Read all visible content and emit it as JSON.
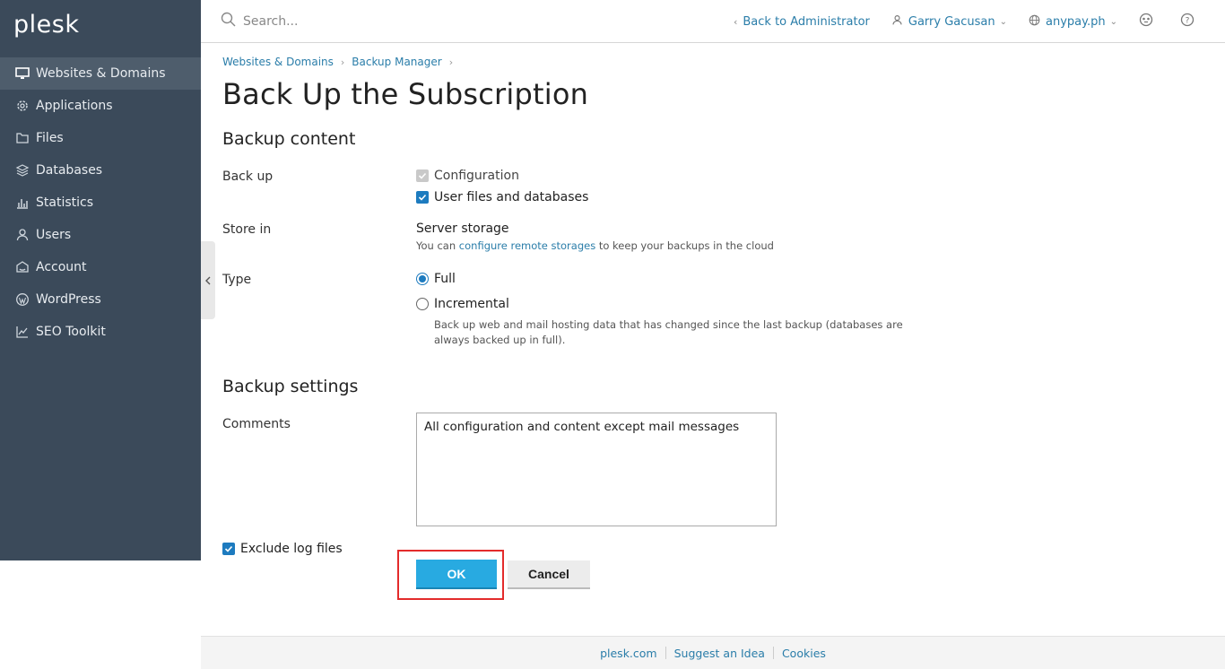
{
  "app": {
    "logo": "plesk"
  },
  "sidebar": {
    "items": [
      {
        "label": "Websites & Domains",
        "icon": "monitor-icon",
        "active": true
      },
      {
        "label": "Applications",
        "icon": "gear-icon"
      },
      {
        "label": "Files",
        "icon": "folder-icon"
      },
      {
        "label": "Databases",
        "icon": "database-layers-icon"
      },
      {
        "label": "Statistics",
        "icon": "bar-chart-icon"
      },
      {
        "label": "Users",
        "icon": "user-icon"
      },
      {
        "label": "Account",
        "icon": "account-icon"
      },
      {
        "label": "WordPress",
        "icon": "wordpress-icon"
      },
      {
        "label": "SEO Toolkit",
        "icon": "seo-chart-icon"
      }
    ]
  },
  "topbar": {
    "search_placeholder": "Search...",
    "back_link": "Back to Administrator",
    "user": "Garry Gacusan",
    "domain": "anypay.ph"
  },
  "breadcrumb": [
    "Websites & Domains",
    "Backup Manager"
  ],
  "page": {
    "title": "Back Up the Subscription",
    "backup_content": {
      "heading": "Backup content",
      "back_up_label": "Back up",
      "options": [
        {
          "label": "Configuration",
          "checked": true,
          "disabled": true
        },
        {
          "label": "User files and databases",
          "checked": true,
          "disabled": false
        }
      ],
      "store_in_label": "Store in",
      "store_in_value": "Server storage",
      "store_hint_pre": "You can",
      "store_hint_link": "configure remote storages",
      "store_hint_post": "to keep your backups in the cloud",
      "type_label": "Type",
      "type_full": "Full",
      "type_incremental": "Incremental",
      "incremental_hint_1": "Back up web and mail hosting data that has changed since the last backup (databases are",
      "incremental_hint_2": "always backed up in full).",
      "selected_type": "Full"
    },
    "backup_settings": {
      "heading": "Backup settings",
      "comments_label": "Comments",
      "comments_value": "All configuration and content except mail messages",
      "exclude_logs_label": "Exclude log files",
      "exclude_logs_checked": true
    },
    "buttons": {
      "ok": "OK",
      "cancel": "Cancel"
    }
  },
  "footer": {
    "links": [
      "plesk.com",
      "Suggest an Idea",
      "Cookies"
    ]
  },
  "colors": {
    "sidebar_bg": "#3b4a5a",
    "accent": "#28aae1",
    "link": "#2a7da9",
    "highlight": "#e32b2b"
  }
}
